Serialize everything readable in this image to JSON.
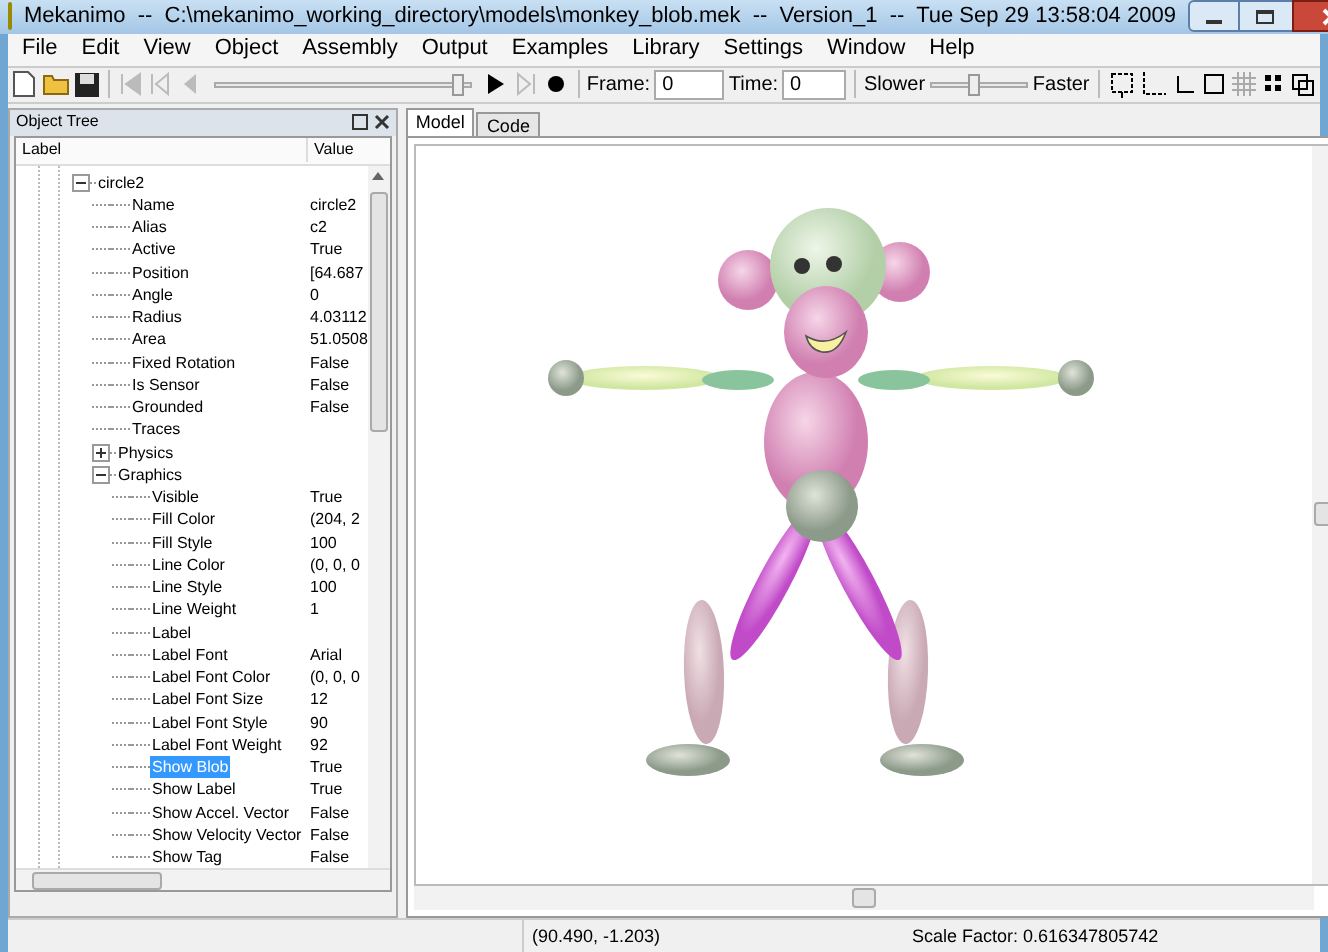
{
  "window": {
    "title": "Mekanimo  --  C:\\mekanimo_working_directory\\models\\monkey_blob.mek  --  Version_1  --  Tue Sep 29 13:58:04 2009"
  },
  "menu": [
    "File",
    "Edit",
    "View",
    "Object",
    "Assembly",
    "Output",
    "Examples",
    "Library",
    "Settings",
    "Window",
    "Help"
  ],
  "toolbar": {
    "timeline": {
      "level": 0.97
    },
    "frame_label": "Frame:",
    "frame_value": "0",
    "time_label": "Time:",
    "time_value": "0",
    "slower_label": "Slower",
    "speed": {
      "level": 0.45
    },
    "faster_label": "Faster"
  },
  "object_tree": {
    "title": "Object Tree",
    "columns": [
      "Label",
      "Value"
    ],
    "items": [
      {
        "label": "circle2",
        "expanded": true,
        "selected": false,
        "children": [
          {
            "label": "Name",
            "value": "circle2",
            "selected": false
          },
          {
            "label": "Alias",
            "value": "c2",
            "selected": false
          },
          {
            "label": "Active",
            "value": "True",
            "selected": false
          },
          {
            "label": "Position",
            "value": "[64.687",
            "selected": false
          },
          {
            "label": "Angle",
            "value": "0",
            "selected": false
          },
          {
            "label": "Radius",
            "value": "4.03112",
            "selected": false
          },
          {
            "label": "Area",
            "value": "51.0508",
            "selected": false
          },
          {
            "label": "Fixed Rotation",
            "value": "False",
            "selected": false
          },
          {
            "label": "Is Sensor",
            "value": "False",
            "selected": false
          },
          {
            "label": "Grounded",
            "value": "False",
            "selected": false
          },
          {
            "label": "Traces",
            "selected": false
          },
          {
            "label": "Physics",
            "expanded": false,
            "selected": false
          },
          {
            "label": "Graphics",
            "expanded": true,
            "selected": false,
            "children": [
              {
                "label": "Visible",
                "value": "True",
                "selected": false
              },
              {
                "label": "Fill Color",
                "value": "(204, 2",
                "selected": false
              },
              {
                "label": "Fill Style",
                "value": "100",
                "selected": false
              },
              {
                "label": "Line Color",
                "value": "(0, 0, 0",
                "selected": false
              },
              {
                "label": "Line Style",
                "value": "100",
                "selected": false
              },
              {
                "label": "Line Weight",
                "value": "1",
                "selected": false
              },
              {
                "label": "Label",
                "selected": false
              },
              {
                "label": "Label Font",
                "value": "Arial",
                "selected": false
              },
              {
                "label": "Label Font Color",
                "value": "(0, 0, 0",
                "selected": false
              },
              {
                "label": "Label Font Size",
                "value": "12",
                "selected": false
              },
              {
                "label": "Label Font Style",
                "value": "90",
                "selected": false
              },
              {
                "label": "Label Font Weight",
                "value": "92",
                "selected": false
              },
              {
                "label": "Show Blob",
                "value": "True",
                "selected": true
              },
              {
                "label": "Show Label",
                "value": "True",
                "selected": false
              },
              {
                "label": "Show Accel. Vector",
                "value": "False",
                "selected": false
              },
              {
                "label": "Show Velocity Vector",
                "value": "False",
                "selected": false
              },
              {
                "label": "Show Tag",
                "value": "False",
                "selected": false
              }
            ]
          }
        ]
      }
    ]
  },
  "tabs": [
    {
      "label": "Model",
      "selected": true
    },
    {
      "label": "Code",
      "selected": false
    }
  ],
  "status_bar": [
    "(90.490, -1.203)",
    "Scale Factor: 0.616347805742"
  ]
}
